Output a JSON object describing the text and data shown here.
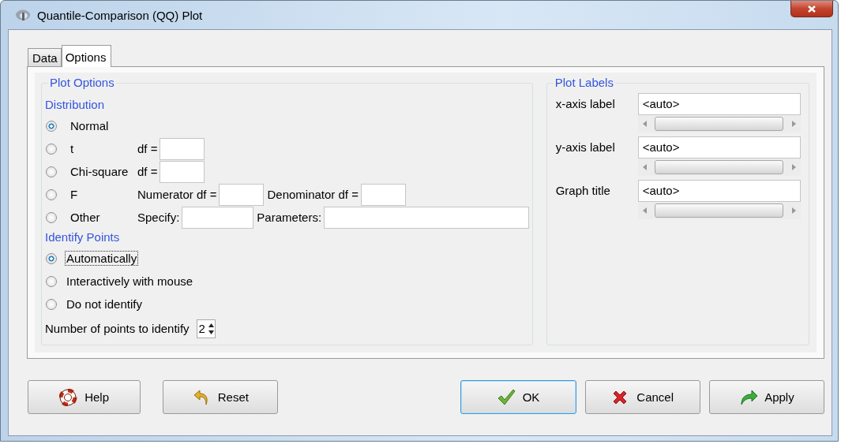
{
  "window": {
    "title": "Quantile-Comparison (QQ) Plot"
  },
  "tabs": [
    {
      "label": "Data",
      "selected": false
    },
    {
      "label": "Options",
      "selected": true
    }
  ],
  "plot_options": {
    "title": "Plot Options",
    "distribution": {
      "heading": "Distribution",
      "options": [
        {
          "label": "Normal",
          "selected": true
        },
        {
          "label": "t",
          "selected": false,
          "params": [
            {
              "label": "df ="
            }
          ]
        },
        {
          "label": "Chi-square",
          "selected": false,
          "params": [
            {
              "label": "df ="
            }
          ]
        },
        {
          "label": "F",
          "selected": false,
          "params": [
            {
              "label": "Numerator df ="
            },
            {
              "label": "Denominator df ="
            }
          ]
        },
        {
          "label": "Other",
          "selected": false,
          "params": [
            {
              "label": "Specify:"
            },
            {
              "label": "Parameters:"
            }
          ]
        }
      ]
    },
    "identify": {
      "heading": "Identify Points",
      "options": [
        {
          "label": "Automatically",
          "selected": true,
          "focused": true
        },
        {
          "label": "Interactively with mouse",
          "selected": false,
          "focused": false
        },
        {
          "label": "Do not identify",
          "selected": false,
          "focused": false
        }
      ]
    },
    "points": {
      "label": "Number of points to identify",
      "value": "2"
    }
  },
  "plot_labels": {
    "title": "Plot Labels",
    "fields": [
      {
        "label": "x-axis label",
        "value": "<auto>"
      },
      {
        "label": "y-axis label",
        "value": "<auto>"
      },
      {
        "label": "Graph title",
        "value": "<auto>"
      }
    ]
  },
  "buttons": [
    {
      "label": "Help",
      "kind": "help",
      "default": false
    },
    {
      "label": "Reset",
      "kind": "reset",
      "default": false
    },
    {
      "label": "OK",
      "kind": "ok",
      "default": true
    },
    {
      "label": "Cancel",
      "kind": "cancel",
      "default": false
    },
    {
      "label": "Apply",
      "kind": "apply",
      "default": false
    }
  ]
}
